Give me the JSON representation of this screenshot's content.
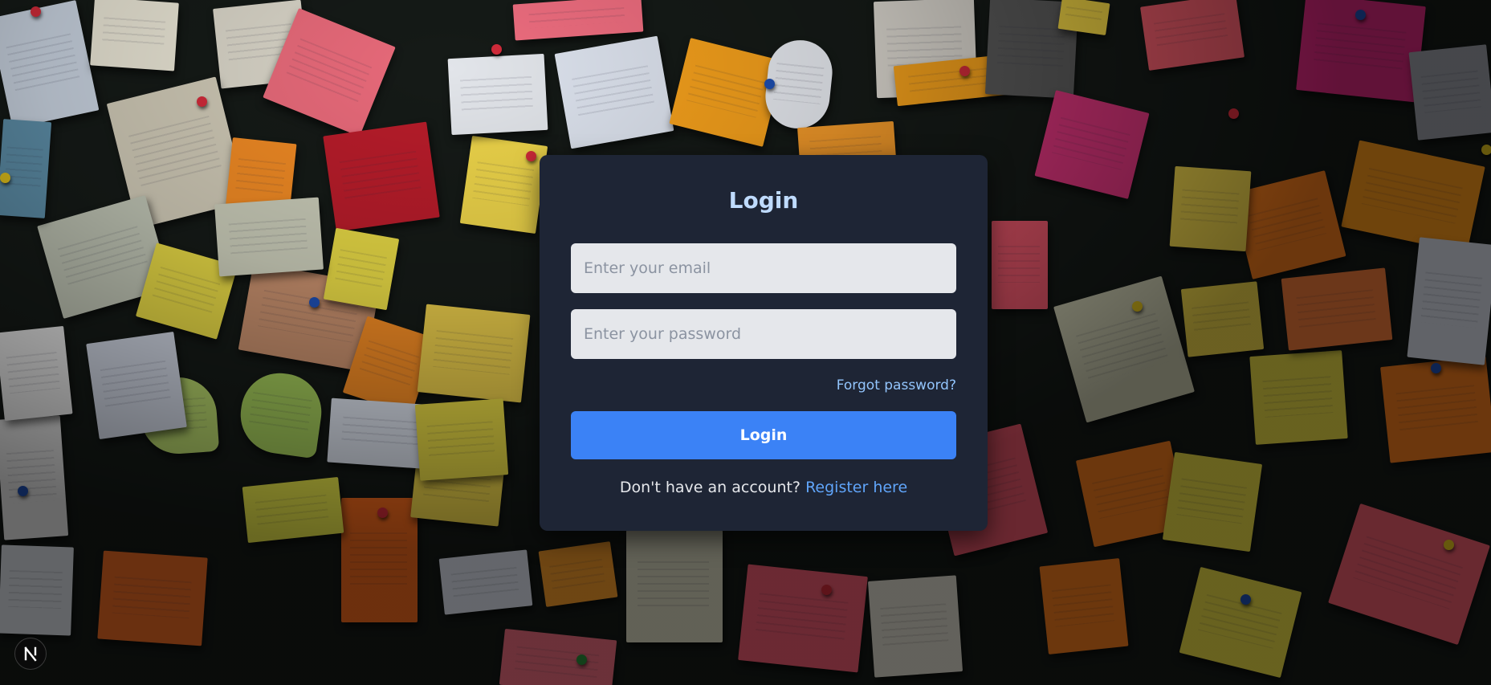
{
  "login_card": {
    "title": "Login",
    "email_placeholder": "Enter your email",
    "password_placeholder": "Enter your password",
    "forgot_password_label": "Forgot password?",
    "submit_label": "Login",
    "register_prompt": "Don't have an account?",
    "register_link_label": "Register here"
  },
  "dev_badge": {
    "letter": "N",
    "icon": "nextjs-logo-icon"
  },
  "background": {
    "description_icon": "sticky-notes-wall-icon"
  },
  "colors": {
    "card_bg": "#1e2535",
    "title": "#bfdbfe",
    "input_bg": "#e5e7eb",
    "button_bg": "#3b82f6",
    "link": "#60a5fa",
    "forgot_link": "#93c5fd"
  }
}
